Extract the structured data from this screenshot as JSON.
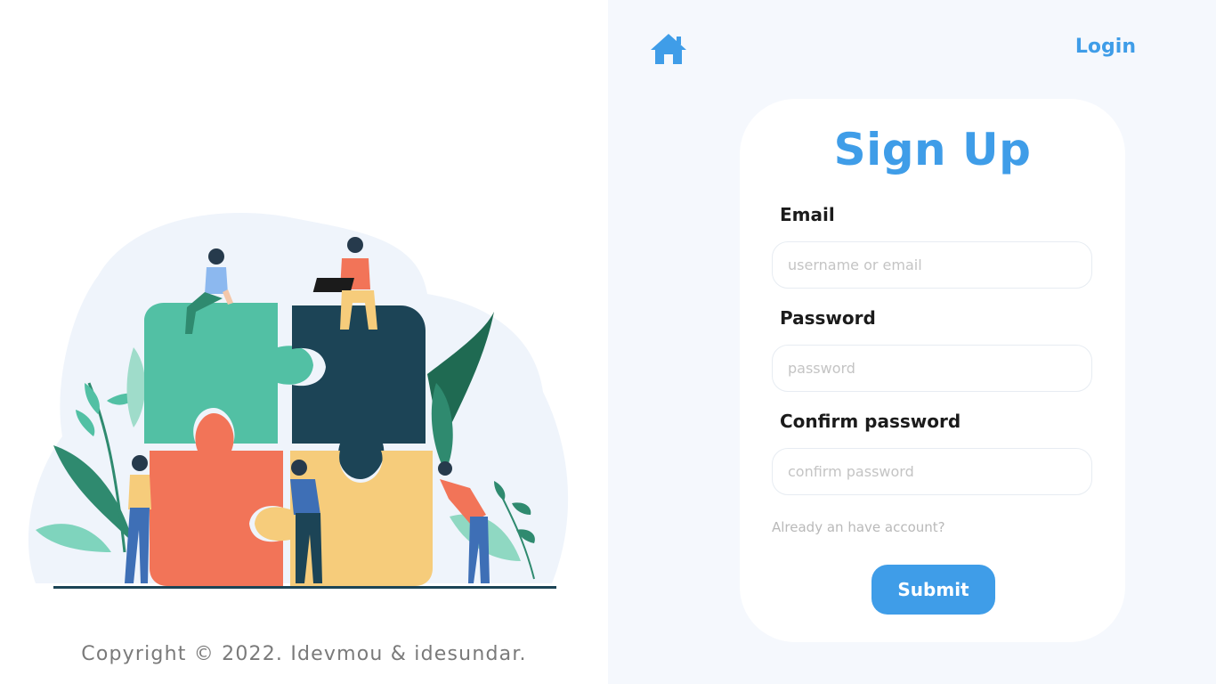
{
  "header": {
    "home_icon": "home-icon",
    "login_label": "Login"
  },
  "form": {
    "title": "Sign Up",
    "email": {
      "label": "Email",
      "placeholder": "username or email",
      "value": ""
    },
    "password": {
      "label": "Password",
      "placeholder": "password",
      "value": ""
    },
    "confirm_password": {
      "label": "Confirm password",
      "placeholder": "confirm password",
      "value": ""
    },
    "already_account_text": "Already an  have account?",
    "submit_label": "Submit"
  },
  "footer": {
    "copyright": "Copyright © 2022. Idevmou & idesundar."
  },
  "colors": {
    "accent": "#3f9de8",
    "right_bg": "#f5f8fd",
    "teal": "#52c0a4",
    "navy": "#1c4456",
    "coral": "#f27458",
    "yellow": "#f6cc7b"
  }
}
